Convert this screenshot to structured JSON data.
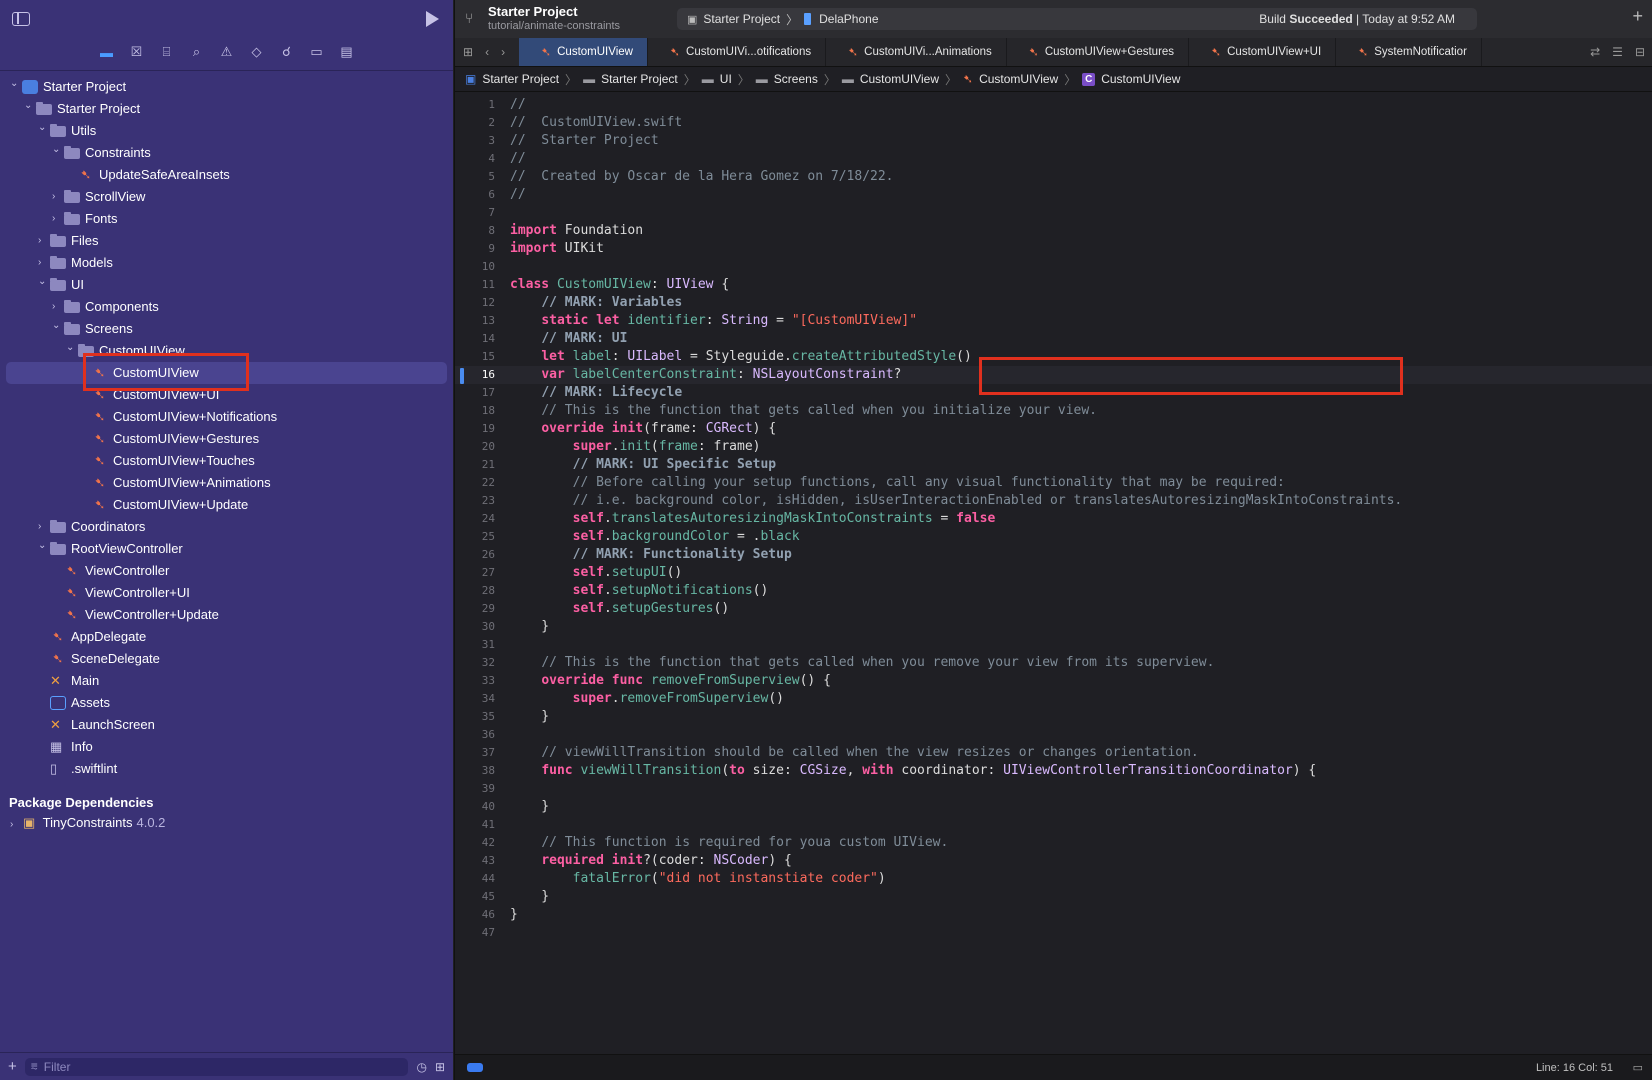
{
  "navigator": {
    "tree": [
      {
        "label": "Starter Project",
        "depth": 0,
        "chev": "open",
        "icon": "project",
        "indent": 10
      },
      {
        "label": "Starter Project",
        "depth": 1,
        "chev": "open",
        "icon": "folder",
        "indent": 24
      },
      {
        "label": "Utils",
        "depth": 2,
        "chev": "open",
        "icon": "folder",
        "indent": 38
      },
      {
        "label": "Constraints",
        "depth": 3,
        "chev": "open",
        "icon": "folder",
        "indent": 52
      },
      {
        "label": "UpdateSafeAreaInsets",
        "depth": 4,
        "chev": "",
        "icon": "swift",
        "indent": 66
      },
      {
        "label": "ScrollView",
        "depth": 3,
        "chev": "closed",
        "icon": "folder",
        "indent": 52
      },
      {
        "label": "Fonts",
        "depth": 3,
        "chev": "closed",
        "icon": "folder",
        "indent": 52
      },
      {
        "label": "Files",
        "depth": 2,
        "chev": "closed",
        "icon": "folder",
        "indent": 38
      },
      {
        "label": "Models",
        "depth": 2,
        "chev": "closed",
        "icon": "folder",
        "indent": 38
      },
      {
        "label": "UI",
        "depth": 2,
        "chev": "open",
        "icon": "folder",
        "indent": 38
      },
      {
        "label": "Components",
        "depth": 3,
        "chev": "closed",
        "icon": "folder",
        "indent": 52
      },
      {
        "label": "Screens",
        "depth": 3,
        "chev": "open",
        "icon": "folder",
        "indent": 52
      },
      {
        "label": "CustomUIView",
        "depth": 4,
        "chev": "open",
        "icon": "folder",
        "indent": 66
      },
      {
        "label": "CustomUIView",
        "depth": 5,
        "chev": "",
        "icon": "swift",
        "indent": 80,
        "selected": true
      },
      {
        "label": "CustomUIView+UI",
        "depth": 5,
        "chev": "",
        "icon": "swift",
        "indent": 80
      },
      {
        "label": "CustomUIView+Notifications",
        "depth": 5,
        "chev": "",
        "icon": "swift",
        "indent": 80
      },
      {
        "label": "CustomUIView+Gestures",
        "depth": 5,
        "chev": "",
        "icon": "swift",
        "indent": 80
      },
      {
        "label": "CustomUIView+Touches",
        "depth": 5,
        "chev": "",
        "icon": "swift",
        "indent": 80
      },
      {
        "label": "CustomUIView+Animations",
        "depth": 5,
        "chev": "",
        "icon": "swift",
        "indent": 80
      },
      {
        "label": "CustomUIView+Update",
        "depth": 5,
        "chev": "",
        "icon": "swift",
        "indent": 80
      },
      {
        "label": "Coordinators",
        "depth": 2,
        "chev": "closed",
        "icon": "folder",
        "indent": 38
      },
      {
        "label": "RootViewController",
        "depth": 2,
        "chev": "open",
        "icon": "folder",
        "indent": 38
      },
      {
        "label": "ViewController",
        "depth": 3,
        "chev": "",
        "icon": "swift",
        "indent": 52
      },
      {
        "label": "ViewController+UI",
        "depth": 3,
        "chev": "",
        "icon": "swift",
        "indent": 52
      },
      {
        "label": "ViewController+Update",
        "depth": 3,
        "chev": "",
        "icon": "swift",
        "indent": 52
      },
      {
        "label": "AppDelegate",
        "depth": 2,
        "chev": "",
        "icon": "swift",
        "indent": 38
      },
      {
        "label": "SceneDelegate",
        "depth": 2,
        "chev": "",
        "icon": "swift",
        "indent": 38
      },
      {
        "label": "Main",
        "depth": 2,
        "chev": "",
        "icon": "storyboard",
        "indent": 38
      },
      {
        "label": "Assets",
        "depth": 2,
        "chev": "",
        "icon": "assets",
        "indent": 38
      },
      {
        "label": "LaunchScreen",
        "depth": 2,
        "chev": "",
        "icon": "storyboard",
        "indent": 38
      },
      {
        "label": "Info",
        "depth": 2,
        "chev": "",
        "icon": "plist",
        "indent": 38
      },
      {
        "label": ".swiftlint",
        "depth": 2,
        "chev": "",
        "icon": "file",
        "indent": 38
      }
    ],
    "package_header": "Package Dependencies",
    "package_name": "TinyConstraints",
    "package_version": "4.0.2",
    "filter_placeholder": "Filter"
  },
  "toolbar": {
    "project_name": "Starter Project",
    "branch": "tutorial/animate-constraints",
    "scheme": "Starter Project",
    "device": "DelaPhone",
    "build_prefix": "Build ",
    "build_status": "Succeeded",
    "build_time": " | Today at 9:52 AM"
  },
  "tabs": [
    {
      "label": "CustomUIView",
      "active": true
    },
    {
      "label": "CustomUIVi...otifications"
    },
    {
      "label": "CustomUIVi...Animations"
    },
    {
      "label": "CustomUIView+Gestures"
    },
    {
      "label": "CustomUIView+UI"
    },
    {
      "label": "SystemNotificatior"
    }
  ],
  "breadcrumb": [
    "Starter Project",
    "Starter Project",
    "UI",
    "Screens",
    "CustomUIView",
    "CustomUIView",
    "CustomUIView"
  ],
  "status": {
    "line_col": "Line: 16  Col: 51"
  },
  "current_line": 16,
  "code_lines": [
    [
      [
        "cm",
        "//"
      ]
    ],
    [
      [
        "cm",
        "//  CustomUIView.swift"
      ]
    ],
    [
      [
        "cm",
        "//  Starter Project"
      ]
    ],
    [
      [
        "cm",
        "//"
      ]
    ],
    [
      [
        "cm",
        "//  Created by Oscar de la Hera Gomez on 7/18/22."
      ]
    ],
    [
      [
        "cm",
        "//"
      ]
    ],
    [],
    [
      [
        "kw",
        "import"
      ],
      [
        "pl",
        " Foundation"
      ]
    ],
    [
      [
        "kw",
        "import"
      ],
      [
        "pl",
        " UIKit"
      ]
    ],
    [],
    [
      [
        "kw",
        "class"
      ],
      [
        "pl",
        " "
      ],
      [
        "fn",
        "CustomUIView"
      ],
      [
        "pl",
        ": "
      ],
      [
        "ty",
        "UIView"
      ],
      [
        "pl",
        " {"
      ]
    ],
    [
      [
        "pl",
        "    "
      ],
      [
        "ms",
        "// MARK: Variables"
      ]
    ],
    [
      [
        "pl",
        "    "
      ],
      [
        "kw",
        "static let"
      ],
      [
        "pl",
        " "
      ],
      [
        "fn",
        "identifier"
      ],
      [
        "pl",
        ": "
      ],
      [
        "ty",
        "String"
      ],
      [
        "pl",
        " = "
      ],
      [
        "st",
        "\"[CustomUIView]\""
      ]
    ],
    [
      [
        "pl",
        "    "
      ],
      [
        "ms",
        "// MARK: UI"
      ]
    ],
    [
      [
        "pl",
        "    "
      ],
      [
        "kw",
        "let"
      ],
      [
        "pl",
        " "
      ],
      [
        "fn",
        "label"
      ],
      [
        "pl",
        ": "
      ],
      [
        "ty",
        "UILabel"
      ],
      [
        "pl",
        " = Styleguide."
      ],
      [
        "fn",
        "createAttributedStyle"
      ],
      [
        "pl",
        "()"
      ]
    ],
    [
      [
        "pl",
        "    "
      ],
      [
        "kw",
        "var"
      ],
      [
        "pl",
        " "
      ],
      [
        "fn",
        "labelCenterConstraint"
      ],
      [
        "pl",
        ": "
      ],
      [
        "ty",
        "NSLayoutConstraint"
      ],
      [
        "pl",
        "?"
      ]
    ],
    [
      [
        "pl",
        "    "
      ],
      [
        "ms",
        "// MARK: Lifecycle"
      ]
    ],
    [
      [
        "pl",
        "    "
      ],
      [
        "cm",
        "// This is the function that gets called when you initialize your view."
      ]
    ],
    [
      [
        "pl",
        "    "
      ],
      [
        "kw",
        "override"
      ],
      [
        "pl",
        " "
      ],
      [
        "kw",
        "init"
      ],
      [
        "pl",
        "(frame: "
      ],
      [
        "ty",
        "CGRect"
      ],
      [
        "pl",
        ") {"
      ]
    ],
    [
      [
        "pl",
        "        "
      ],
      [
        "kw",
        "super"
      ],
      [
        "pl",
        "."
      ],
      [
        "fn",
        "init"
      ],
      [
        "pl",
        "("
      ],
      [
        "fn",
        "frame"
      ],
      [
        "pl",
        ": frame)"
      ]
    ],
    [
      [
        "pl",
        "        "
      ],
      [
        "ms",
        "// MARK: UI Specific Setup"
      ]
    ],
    [
      [
        "pl",
        "        "
      ],
      [
        "cm",
        "// Before calling your setup functions, call any visual functionality that may be required:"
      ]
    ],
    [
      [
        "pl",
        "        "
      ],
      [
        "cm",
        "// i.e. background color, isHidden, isUserInteractionEnabled or translatesAutoresizingMaskIntoConstraints."
      ]
    ],
    [
      [
        "pl",
        "        "
      ],
      [
        "kw",
        "self"
      ],
      [
        "pl",
        "."
      ],
      [
        "fn",
        "translatesAutoresizingMaskIntoConstraints"
      ],
      [
        "pl",
        " = "
      ],
      [
        "kw",
        "false"
      ]
    ],
    [
      [
        "pl",
        "        "
      ],
      [
        "kw",
        "self"
      ],
      [
        "pl",
        "."
      ],
      [
        "fn",
        "backgroundColor"
      ],
      [
        "pl",
        " = ."
      ],
      [
        "fn",
        "black"
      ]
    ],
    [
      [
        "pl",
        "        "
      ],
      [
        "ms",
        "// MARK: Functionality Setup"
      ]
    ],
    [
      [
        "pl",
        "        "
      ],
      [
        "kw",
        "self"
      ],
      [
        "pl",
        "."
      ],
      [
        "fn",
        "setupUI"
      ],
      [
        "pl",
        "()"
      ]
    ],
    [
      [
        "pl",
        "        "
      ],
      [
        "kw",
        "self"
      ],
      [
        "pl",
        "."
      ],
      [
        "fn",
        "setupNotifications"
      ],
      [
        "pl",
        "()"
      ]
    ],
    [
      [
        "pl",
        "        "
      ],
      [
        "kw",
        "self"
      ],
      [
        "pl",
        "."
      ],
      [
        "fn",
        "setupGestures"
      ],
      [
        "pl",
        "()"
      ]
    ],
    [
      [
        "pl",
        "    }"
      ]
    ],
    [],
    [
      [
        "pl",
        "    "
      ],
      [
        "cm",
        "// This is the function that gets called when you remove your view from its superview."
      ]
    ],
    [
      [
        "pl",
        "    "
      ],
      [
        "kw",
        "override func"
      ],
      [
        "pl",
        " "
      ],
      [
        "fn",
        "removeFromSuperview"
      ],
      [
        "pl",
        "() {"
      ]
    ],
    [
      [
        "pl",
        "        "
      ],
      [
        "kw",
        "super"
      ],
      [
        "pl",
        "."
      ],
      [
        "fn",
        "removeFromSuperview"
      ],
      [
        "pl",
        "()"
      ]
    ],
    [
      [
        "pl",
        "    }"
      ]
    ],
    [],
    [
      [
        "pl",
        "    "
      ],
      [
        "cm",
        "// viewWillTransition should be called when the view resizes or changes orientation."
      ]
    ],
    [
      [
        "pl",
        "    "
      ],
      [
        "kw",
        "func"
      ],
      [
        "pl",
        " "
      ],
      [
        "fn",
        "viewWillTransition"
      ],
      [
        "pl",
        "("
      ],
      [
        "kw",
        "to"
      ],
      [
        "pl",
        " size: "
      ],
      [
        "ty",
        "CGSize"
      ],
      [
        "pl",
        ", "
      ],
      [
        "kw",
        "with"
      ],
      [
        "pl",
        " coordinator: "
      ],
      [
        "ty",
        "UIViewControllerTransitionCoordinator"
      ],
      [
        "pl",
        ") {"
      ]
    ],
    [],
    [
      [
        "pl",
        "    }"
      ]
    ],
    [],
    [
      [
        "pl",
        "    "
      ],
      [
        "cm",
        "// This function is required for youa custom UIView."
      ]
    ],
    [
      [
        "pl",
        "    "
      ],
      [
        "kw",
        "required"
      ],
      [
        "pl",
        " "
      ],
      [
        "kw",
        "init"
      ],
      [
        "pl",
        "?(coder: "
      ],
      [
        "ty",
        "NSCoder"
      ],
      [
        "pl",
        ") {"
      ]
    ],
    [
      [
        "pl",
        "        "
      ],
      [
        "fn",
        "fatalError"
      ],
      [
        "pl",
        "("
      ],
      [
        "st",
        "\"did not instanstiate coder\""
      ],
      [
        "pl",
        ")"
      ]
    ],
    [
      [
        "pl",
        "    }"
      ]
    ],
    [
      [
        "pl",
        "}"
      ]
    ],
    []
  ]
}
